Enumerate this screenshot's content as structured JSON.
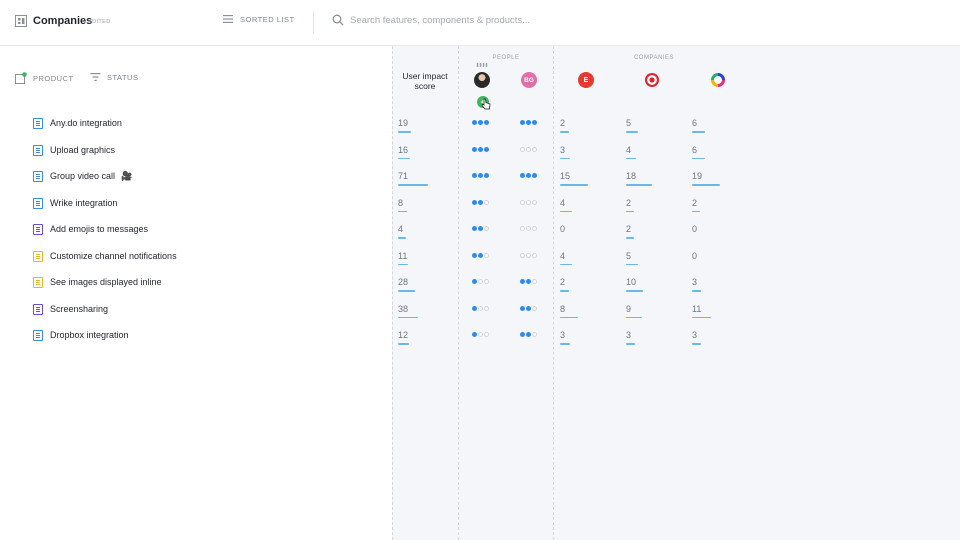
{
  "header": {
    "title": "Companies",
    "badge": "EDITED",
    "sort_label": "SORTED LIST",
    "search_placeholder": "Search features, components & products..."
  },
  "columns": {
    "product": "PRODUCT",
    "status": "STATUS",
    "score": "User impact score",
    "people_group": "PEOPLE",
    "companies_group": "COMPANIES",
    "people": [
      {
        "name": "person-avatar-icon",
        "initials": ""
      },
      {
        "name": "bg-avatar",
        "initials": "BG"
      }
    ],
    "companies": [
      {
        "name": "e-logo-icon",
        "initials": "E"
      },
      {
        "name": "target-logo-icon",
        "initials": ""
      },
      {
        "name": "ring-logo-icon",
        "initials": ""
      }
    ]
  },
  "colors": {
    "accent": "#2f8be6",
    "bar": "#6ab7e8",
    "blue_doc": "#3b8ed6",
    "purple_doc": "#6b4fc8",
    "yellow_doc": "#e8b820",
    "add": "#3cb55e"
  },
  "rows": [
    {
      "name": "Any.do integration",
      "icon_color": "#3b8ed6",
      "camera": false,
      "score": 19,
      "p1": 3,
      "p2": 3,
      "c1": 2,
      "c2": 5,
      "c3": 6
    },
    {
      "name": "Upload graphics",
      "icon_color": "#3b8ed6",
      "camera": false,
      "score": 16,
      "p1": 3,
      "p2": 0,
      "c1": 3,
      "c2": 4,
      "c3": 6
    },
    {
      "name": "Group video call",
      "icon_color": "#3b8ed6",
      "camera": true,
      "score": 71,
      "p1": 3,
      "p2": 3,
      "c1": 15,
      "c2": 18,
      "c3": 19
    },
    {
      "name": "Wrike integration",
      "icon_color": "#3b8ed6",
      "camera": false,
      "score": 8,
      "p1": 2,
      "p2": 0,
      "c1": 4,
      "c2": 2,
      "c3": 2
    },
    {
      "name": "Add emojis to messages",
      "icon_color": "#6b4fc8",
      "camera": false,
      "score": 4,
      "p1": 2,
      "p2": 0,
      "c1": 0,
      "c2": 2,
      "c3": 0
    },
    {
      "name": "Customize channel notifications",
      "icon_color": "#e8b820",
      "camera": false,
      "score": 11,
      "p1": 2,
      "p2": 0,
      "c1": 4,
      "c2": 5,
      "c3": 0
    },
    {
      "name": "See images displayed inline",
      "icon_color": "#e8b820",
      "camera": false,
      "score": 28,
      "p1": 1,
      "p2": 2,
      "c1": 2,
      "c2": 10,
      "c3": 3
    },
    {
      "name": "Screensharing",
      "icon_color": "#6b4fc8",
      "camera": false,
      "score": 38,
      "p1": 1,
      "p2": 2,
      "c1": 8,
      "c2": 9,
      "c3": 11
    },
    {
      "name": "Dropbox integration",
      "icon_color": "#3b8ed6",
      "camera": false,
      "score": 12,
      "p1": 1,
      "p2": 2,
      "c1": 3,
      "c2": 3,
      "c3": 3
    }
  ]
}
